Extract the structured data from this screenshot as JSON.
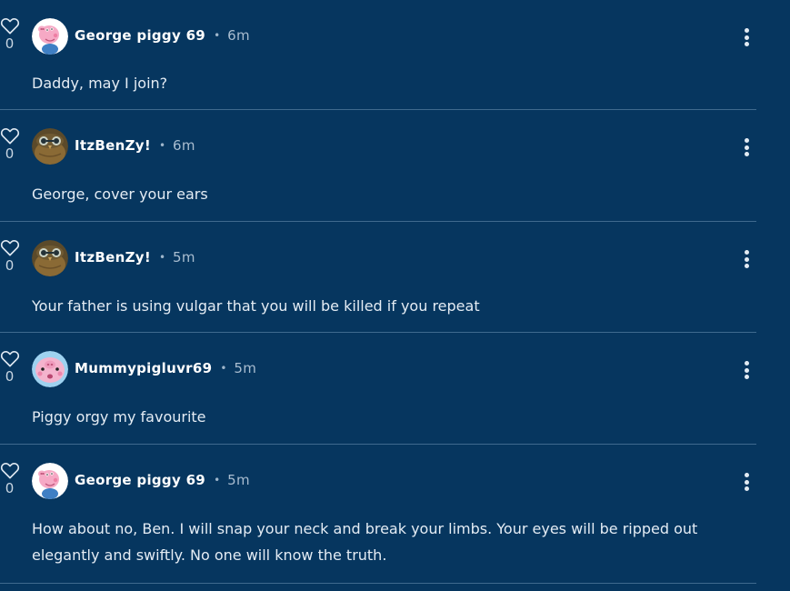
{
  "colors": {
    "background": "#06365f",
    "divider": "#3f6a8e",
    "text": "#e4ecf4",
    "muted": "#a9bdd0"
  },
  "comments": [
    {
      "likes": "0",
      "username": "George piggy 69",
      "separator": "•",
      "time": "6m",
      "text": "Daddy, may I join?",
      "avatar": "george-pig-avatar"
    },
    {
      "likes": "0",
      "username": "ItzBenZy!",
      "separator": "•",
      "time": "6m",
      "text": "George, cover your ears",
      "avatar": "owl-avatar"
    },
    {
      "likes": "0",
      "username": "ItzBenZy!",
      "separator": "•",
      "time": "5m",
      "text": "Your father is using vulgar that you will be killed if you repeat",
      "avatar": "owl-avatar"
    },
    {
      "likes": "0",
      "username": "Mummypigluvr69",
      "separator": "•",
      "time": "5m",
      "text": "Piggy orgy my favourite",
      "avatar": "pig-face-avatar"
    },
    {
      "likes": "0",
      "username": "George piggy 69",
      "separator": "•",
      "time": "5m",
      "text": "How about no, Ben. I will snap your neck and break your limbs. Your eyes will be ripped out elegantly and swiftly. No one will know the truth.",
      "avatar": "george-pig-avatar"
    }
  ]
}
